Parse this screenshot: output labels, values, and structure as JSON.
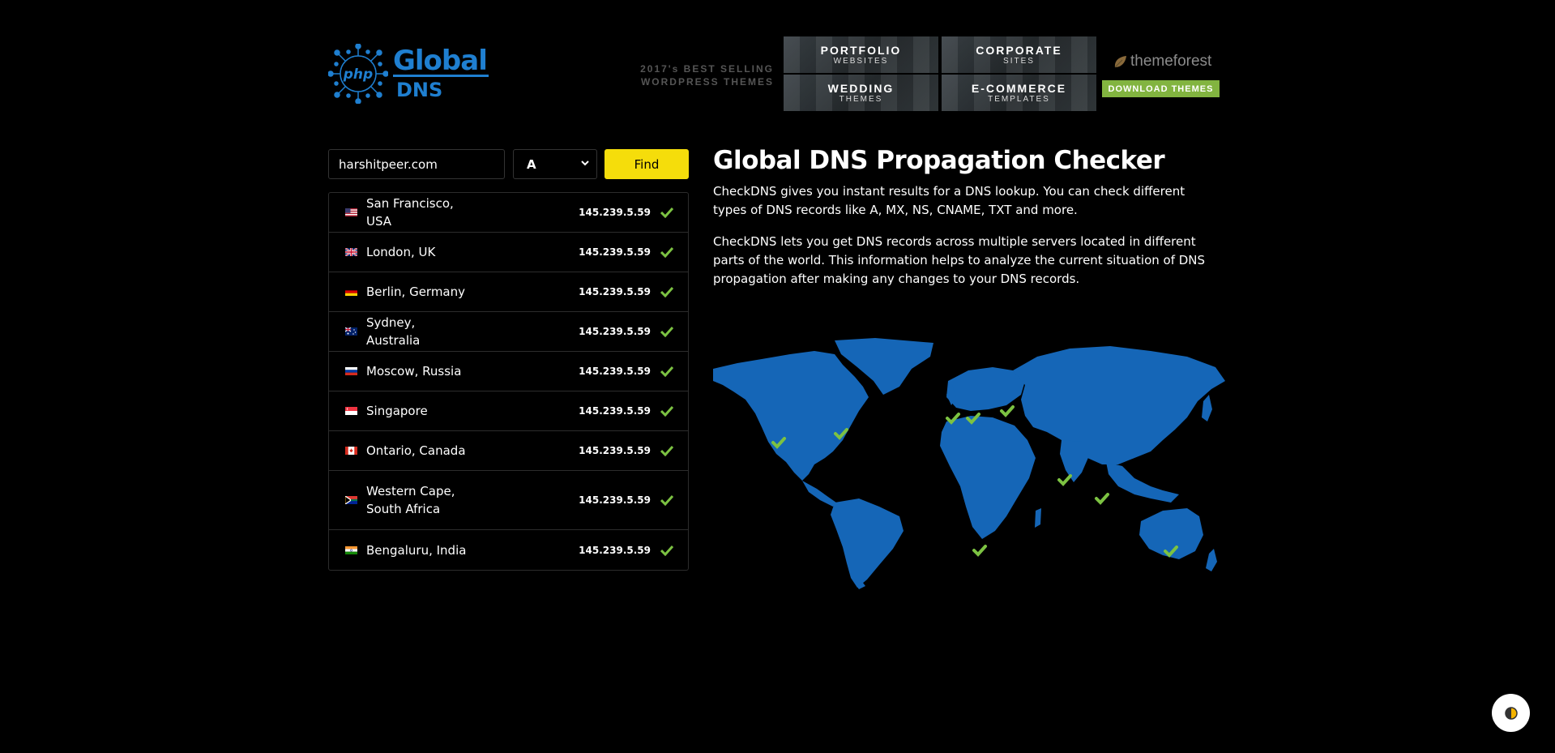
{
  "header": {
    "logo": {
      "badge": "php",
      "line1": "Global",
      "line2": "DNS"
    },
    "ad": {
      "tagline1": "2017's BEST SELLING",
      "tagline2": "WORDPRESS THEMES",
      "tiles": [
        {
          "title": "PORTFOLIO",
          "subtitle": "WEBSITES"
        },
        {
          "title": "CORPORATE",
          "subtitle": "SITES"
        },
        {
          "title": "WEDDING",
          "subtitle": "THEMES"
        },
        {
          "title": "E-COMMERCE",
          "subtitle": "TEMPLATES"
        }
      ],
      "brand": "themeforest",
      "button": "DOWNLOAD THEMES"
    }
  },
  "search": {
    "domain_value": "harshitpeer.com",
    "record_type": "A",
    "find_label": "Find"
  },
  "results": [
    {
      "location": "San Francisco, USA",
      "flag": "us-flag-icon",
      "ip": "145.239.5.59"
    },
    {
      "location": "London, UK",
      "flag": "uk-flag-icon",
      "ip": "145.239.5.59"
    },
    {
      "location": "Berlin, Germany",
      "flag": "de-flag-icon",
      "ip": "145.239.5.59"
    },
    {
      "location": "Sydney, Australia",
      "flag": "au-flag-icon",
      "ip": "145.239.5.59"
    },
    {
      "location": "Moscow, Russia",
      "flag": "ru-flag-icon",
      "ip": "145.239.5.59"
    },
    {
      "location": "Singapore",
      "flag": "sg-flag-icon",
      "ip": "145.239.5.59"
    },
    {
      "location": "Ontario, Canada",
      "flag": "ca-flag-icon",
      "ip": "145.239.5.59"
    },
    {
      "location": "Western Cape, South Africa",
      "flag": "za-flag-icon",
      "ip": "145.239.5.59"
    },
    {
      "location": "Bengaluru, India",
      "flag": "in-flag-icon",
      "ip": "145.239.5.59"
    }
  ],
  "info": {
    "title": "Global DNS Propagation Checker",
    "paragraph1": "CheckDNS gives you instant results for a DNS lookup. You can check different types of DNS records like A, MX, NS, CNAME, TXT and more.",
    "paragraph2": "CheckDNS lets you get DNS records across multiple servers located in different parts of the world. This information helps to analyze the current situation of DNS propagation after making any changes to your DNS records."
  },
  "colors": {
    "accent_yellow": "#f5dd0b",
    "map_blue": "#1566b7",
    "check_green": "#7cc242",
    "logo_blue": "#1f7fd0",
    "themeforest_green": "#82b440"
  },
  "icons": {
    "check": "check-icon",
    "theme_toggle": "half-moon-icon"
  }
}
